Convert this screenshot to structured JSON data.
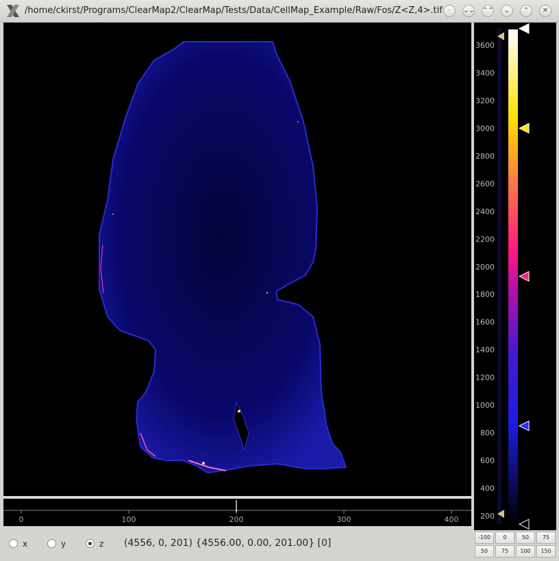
{
  "window": {
    "title": "/home/ckirst/Programs/ClearMap2/ClearMap/Tests/Data/CellMap_Example/Raw/Fos/Z<Z,4>.tif",
    "buttons": [
      "·",
      "⌄⌄",
      "⌃⌃",
      "⌄",
      "⌃",
      "✕"
    ]
  },
  "slider": {
    "ticks": [
      "0",
      "100",
      "200",
      "300",
      "400"
    ],
    "value": 200
  },
  "colorbar": {
    "ticks": [
      "3600",
      "3400",
      "3200",
      "3000",
      "2800",
      "2600",
      "2400",
      "2200",
      "2000",
      "1800",
      "1600",
      "1400",
      "1200",
      "1000",
      "800",
      "600",
      "400",
      "200"
    ],
    "markers": [
      {
        "name": "white",
        "color": "#ffffff",
        "value": 3720
      },
      {
        "name": "yellow",
        "color": "#ffe600",
        "value": 3000
      },
      {
        "name": "pink",
        "color": "#ff1f8f",
        "value": 1930
      },
      {
        "name": "blue",
        "color": "#2230ff",
        "value": 850
      },
      {
        "name": "black",
        "color": "#000000",
        "value": 140
      }
    ]
  },
  "axis_options": [
    {
      "label": "x",
      "checked": false
    },
    {
      "label": "y",
      "checked": false
    },
    {
      "label": "z",
      "checked": true
    }
  ],
  "coordinates": "(4556, 0, 201) {4556.00, 0.00, 201.00} [0]",
  "levels": {
    "row1": [
      "-100",
      "0",
      "50",
      "75"
    ],
    "row2": [
      "50",
      "75",
      "100",
      "150"
    ]
  },
  "colors": {
    "tissue": "#09096e",
    "bright": "#ff3b8f"
  }
}
